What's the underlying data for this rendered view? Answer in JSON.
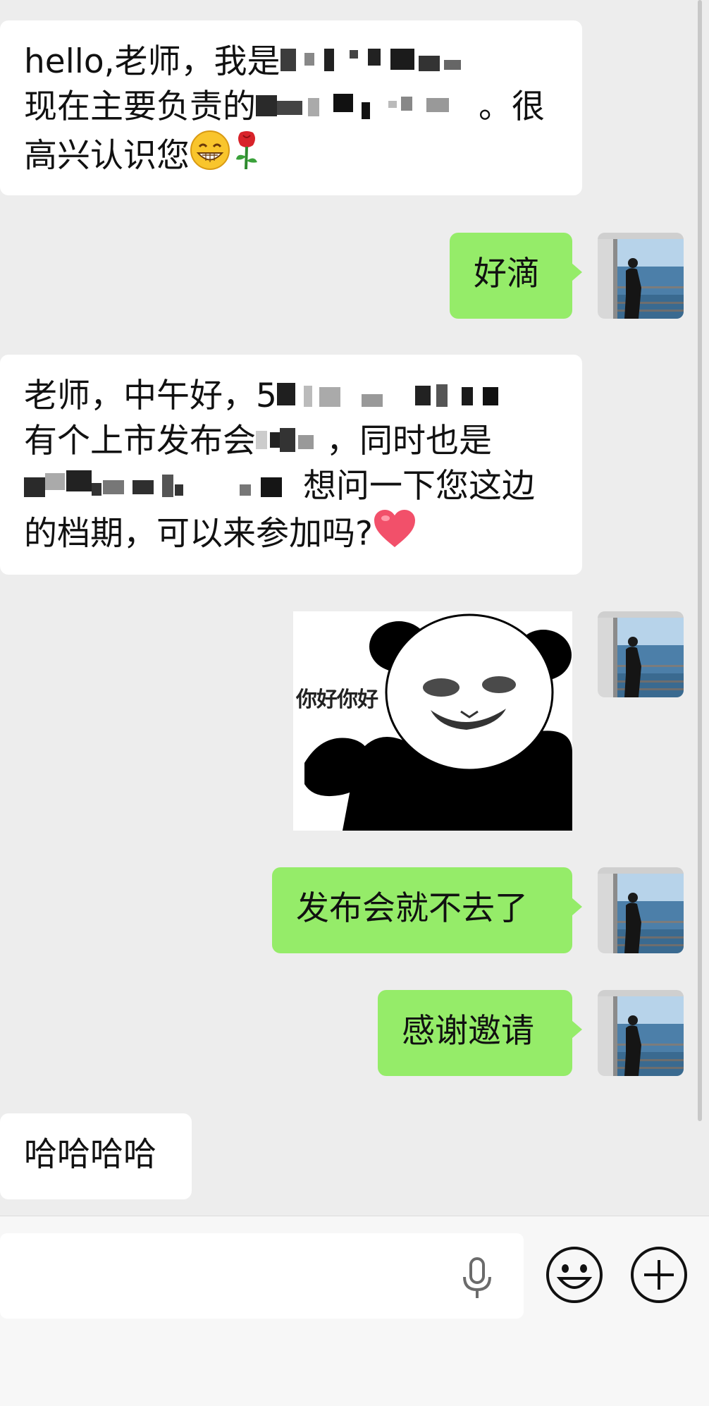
{
  "messages": [
    {
      "side": "in",
      "line1": "hello,老师，我是",
      "line2a": "现在主要负责的",
      "line2b": "。很",
      "line3": "高兴认识您"
    },
    {
      "side": "out",
      "text": "好滴"
    },
    {
      "side": "in",
      "line1": "老师，中午好，5",
      "line2a": "有个上市发布会",
      "line2b": "，同时也是",
      "line3": "想问一下您这边",
      "line4": "的档期，可以来参加吗?"
    },
    {
      "side": "out",
      "type": "sticker",
      "caption": "你好你好"
    },
    {
      "side": "out",
      "text": "发布会就不去了"
    },
    {
      "side": "out",
      "text": "感谢邀请"
    },
    {
      "side": "in",
      "text": "哈哈哈哈"
    }
  ],
  "icons": {
    "emoji_grin": "grinning-face-emoji",
    "emoji_rose": "rose-emoji",
    "emoji_heart": "heart-emoji",
    "mic": "microphone-icon",
    "smile": "smiley-icon",
    "plus": "plus-icon"
  },
  "colors": {
    "outgoing_bubble": "#95ec69",
    "incoming_bubble": "#ffffff",
    "background": "#ededed"
  }
}
